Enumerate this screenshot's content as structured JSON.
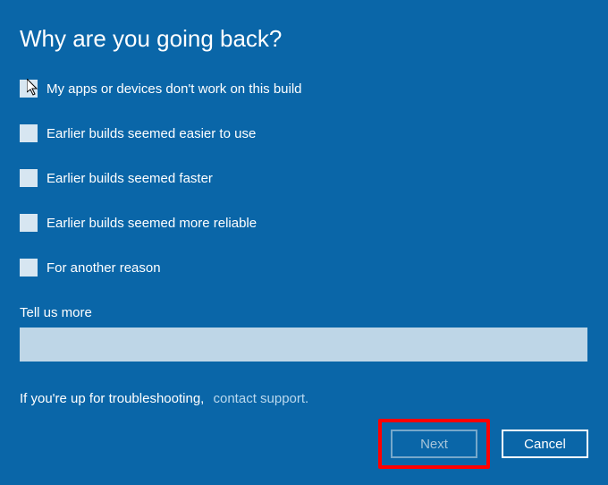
{
  "title": "Why are you going back?",
  "options": {
    "opt1": "My apps or devices don't work on this build",
    "opt2": "Earlier builds seemed easier to use",
    "opt3": "Earlier builds seemed faster",
    "opt4": "Earlier builds seemed more reliable",
    "opt5": "For another reason"
  },
  "tellMoreLabel": "Tell us more",
  "tellMoreValue": "",
  "troubleshootText": "If you're up for troubleshooting,",
  "contactSupportText": "contact support.",
  "buttons": {
    "next": "Next",
    "cancel": "Cancel"
  }
}
